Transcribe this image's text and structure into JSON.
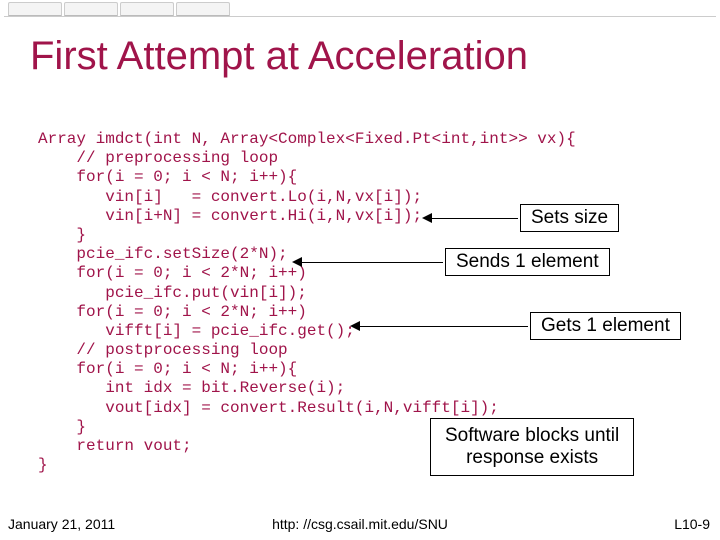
{
  "title": "First Attempt at Acceleration",
  "code": {
    "l1": "Array imdct(int N, Array<Complex<Fixed.Pt<int,int>> vx){",
    "l2": "    // preprocessing loop",
    "l3": "    for(i = 0; i < N; i++){",
    "l4": "       vin[i]   = convert.Lo(i,N,vx[i]);",
    "l5": "       vin[i+N] = convert.Hi(i,N,vx[i]);",
    "l6": "    }",
    "l7": "    pcie_ifc.setSize(2*N);",
    "l8": "    for(i = 0; i < 2*N; i++)",
    "l9": "       pcie_ifc.put(vin[i]);",
    "l10": "    for(i = 0; i < 2*N; i++)",
    "l11": "       vifft[i] = pcie_ifc.get();",
    "l12": "    // postprocessing loop",
    "l13": "    for(i = 0; i < N; i++){",
    "l14": "       int idx = bit.Reverse(i);",
    "l15": "       vout[idx] = convert.Result(i,N,vifft[i]);",
    "l16": "    }",
    "l17": "    return vout;",
    "l18": "}"
  },
  "annotations": {
    "sets_size": "Sets size",
    "sends_one": "Sends 1 element",
    "gets_one": "Gets 1 element",
    "blocks": "Software blocks until\nresponse exists"
  },
  "footer": {
    "date": "January 21, 2011",
    "url": "http: //csg.csail.mit.edu/SNU",
    "num": "L10-9"
  }
}
